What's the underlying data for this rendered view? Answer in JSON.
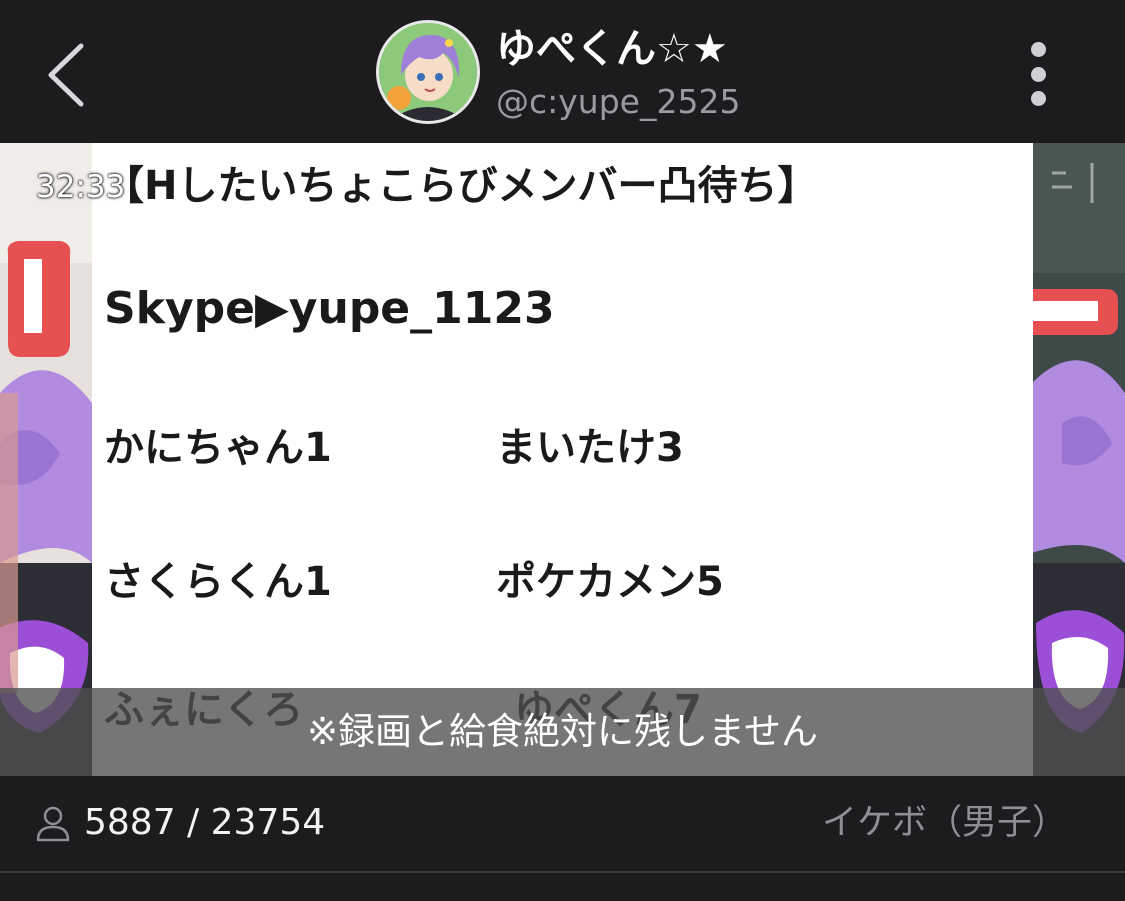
{
  "header": {
    "user_name": "ゆぺくん☆★",
    "user_handle": "@c:yupe_2525"
  },
  "stream": {
    "timer": "32:33",
    "card": {
      "title": "【Hしたいちょこらびメンバー凸待ち】",
      "skype": "Skype▶yupe_1123",
      "members": [
        "かにちゃん1",
        "まいたけ3",
        "さくらくん1",
        "ポケカメン5",
        "ふぇにくろ",
        "ゆぺくん7"
      ]
    },
    "caption": "※録画と給食絶対に残しません"
  },
  "footer": {
    "viewers": "5887 / 23754",
    "category": "イケボ（男子）"
  },
  "colors": {
    "background": "#1c1c1e",
    "text_primary": "#ffffff",
    "text_secondary": "#9a9a9f",
    "caption_bg": "#505050"
  },
  "icons": [
    "back-arrow-icon",
    "more-vertical-icon",
    "person-icon"
  ]
}
